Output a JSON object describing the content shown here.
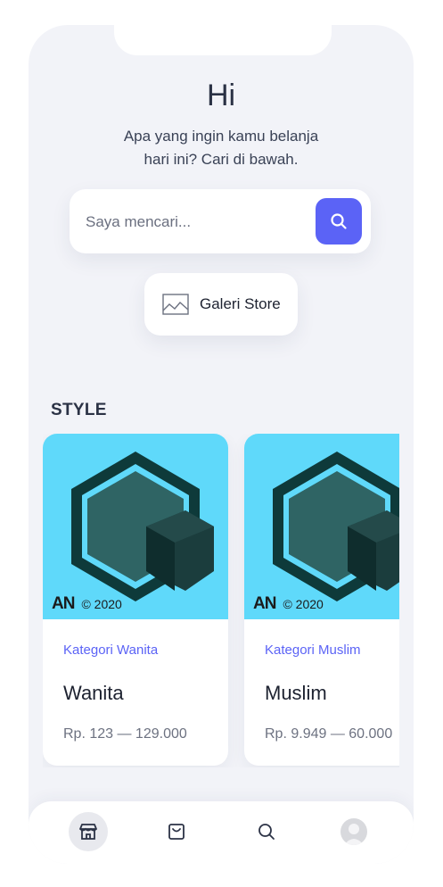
{
  "greeting": "Hi",
  "subtitle": {
    "line1": "Apa yang ingin kamu belanja",
    "line2": "hari ini? Cari di bawah."
  },
  "search": {
    "placeholder": "Saya mencari...",
    "button_icon": "search-icon"
  },
  "gallery_button": {
    "icon": "image-icon",
    "label": "Galeri Store"
  },
  "section": {
    "title": "STYLE"
  },
  "products": [
    {
      "brand_logo": "AN",
      "copyright": "© 2020",
      "category": "Kategori Wanita",
      "name": "Wanita",
      "price": "Rp. 123 — 129.000"
    },
    {
      "brand_logo": "AN",
      "copyright": "© 2020",
      "category": "Kategori Muslim",
      "name": "Muslim",
      "price": "Rp. 9.949 — 60.000"
    }
  ],
  "bottom_nav": [
    {
      "icon": "store-icon",
      "active": true
    },
    {
      "icon": "shopping-bag-icon",
      "active": false
    },
    {
      "icon": "search-icon",
      "active": false
    },
    {
      "icon": "profile-avatar",
      "active": false
    }
  ],
  "colors": {
    "accent": "#5b63f6",
    "background": "#f2f3f8",
    "card_image_bg": "#5fd9fa"
  }
}
